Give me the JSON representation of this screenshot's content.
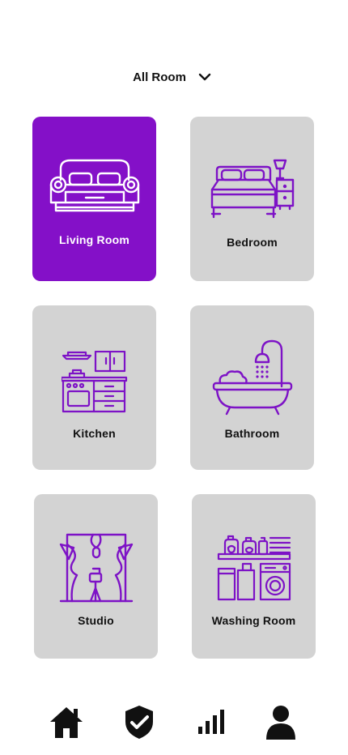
{
  "filter": {
    "label": "All Room",
    "icon": "chevron-down-icon"
  },
  "rooms": [
    {
      "label": "Living Room",
      "icon": "sofa-icon",
      "active": true
    },
    {
      "label": "Bedroom",
      "icon": "bed-icon",
      "active": false
    },
    {
      "label": "Kitchen",
      "icon": "kitchen-icon",
      "active": false
    },
    {
      "label": "Bathroom",
      "icon": "bathtub-icon",
      "active": false
    },
    {
      "label": "Studio",
      "icon": "studio-icon",
      "active": false
    },
    {
      "label": "Washing Room",
      "icon": "washing-machine-icon",
      "active": false
    }
  ],
  "nav": [
    {
      "icon": "home-icon"
    },
    {
      "icon": "shield-check-icon"
    },
    {
      "icon": "signal-bars-icon"
    },
    {
      "icon": "user-icon"
    }
  ],
  "colors": {
    "accent": "#8410c8",
    "card": "#d3d3d3",
    "icon": "#7d12c6",
    "nav": "#111111"
  }
}
